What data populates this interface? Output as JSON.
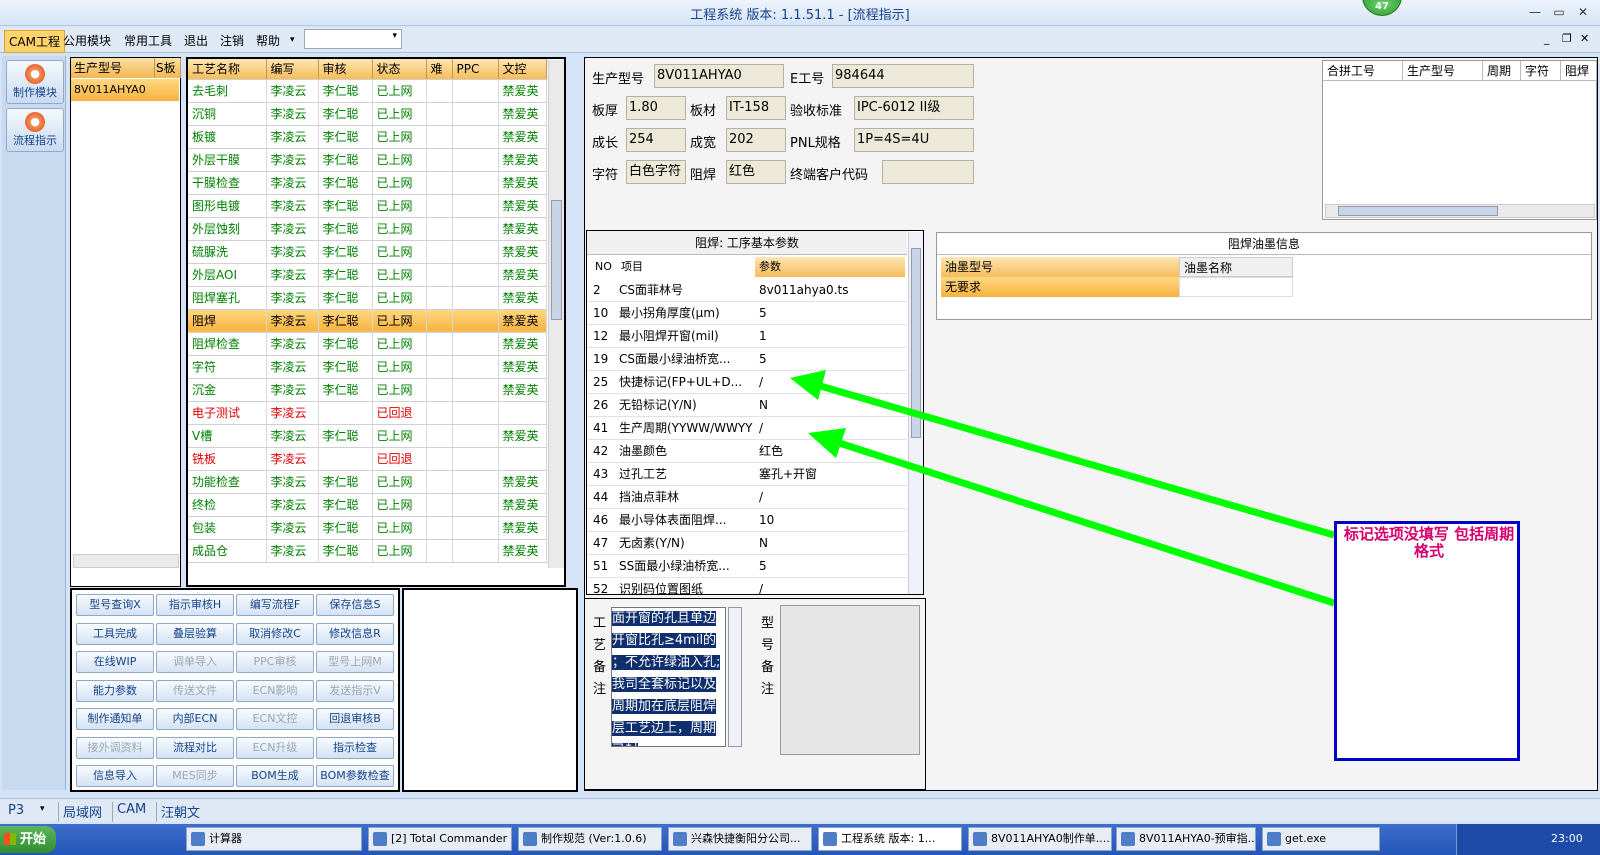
{
  "window": {
    "title": "工程系统  版本: 1.1.51.1 - [流程指示]",
    "badge_count": "47"
  },
  "menu": {
    "items": [
      "CAM工程",
      "公用模块",
      "常用工具",
      "退出",
      "注销",
      "帮助"
    ],
    "dropdown_arrow": "▾"
  },
  "rail": {
    "buttons": [
      "制作模块",
      "流程指示"
    ]
  },
  "model_list": {
    "headers": [
      "生产型号",
      "S板"
    ],
    "rows": [
      "8V011AHYA0"
    ]
  },
  "process": {
    "headers": [
      "工艺名称",
      "编写",
      "审核",
      "状态",
      "难",
      "PPC",
      "文控"
    ],
    "rows": [
      [
        "去毛刺",
        "李凌云",
        "李仁聪",
        "已上网",
        "",
        "",
        "禁爱英",
        "green"
      ],
      [
        "沉铜",
        "李凌云",
        "李仁聪",
        "已上网",
        "",
        "",
        "禁爱英",
        "green"
      ],
      [
        "板镀",
        "李凌云",
        "李仁聪",
        "已上网",
        "",
        "",
        "禁爱英",
        "green"
      ],
      [
        "外层干膜",
        "李凌云",
        "李仁聪",
        "已上网",
        "",
        "",
        "禁爱英",
        "green"
      ],
      [
        "干膜检查",
        "李凌云",
        "李仁聪",
        "已上网",
        "",
        "",
        "禁爱英",
        "green"
      ],
      [
        "图形电镀",
        "李凌云",
        "李仁聪",
        "已上网",
        "",
        "",
        "禁爱英",
        "green"
      ],
      [
        "外层蚀刻",
        "李凌云",
        "李仁聪",
        "已上网",
        "",
        "",
        "禁爱英",
        "green"
      ],
      [
        "硫脲洗",
        "李凌云",
        "李仁聪",
        "已上网",
        "",
        "",
        "禁爱英",
        "green"
      ],
      [
        "外层AOI",
        "李凌云",
        "李仁聪",
        "已上网",
        "",
        "",
        "禁爱英",
        "green"
      ],
      [
        "阻焊塞孔",
        "李凌云",
        "李仁聪",
        "已上网",
        "",
        "",
        "禁爱英",
        "green"
      ],
      [
        "阻焊",
        "李凌云",
        "李仁聪",
        "已上网",
        "",
        "",
        "禁爱英",
        "selected"
      ],
      [
        "阻焊检查",
        "李凌云",
        "李仁聪",
        "已上网",
        "",
        "",
        "禁爱英",
        "green"
      ],
      [
        "字符",
        "李凌云",
        "李仁聪",
        "已上网",
        "",
        "",
        "禁爱英",
        "green"
      ],
      [
        "沉金",
        "李凌云",
        "李仁聪",
        "已上网",
        "",
        "",
        "禁爱英",
        "green"
      ],
      [
        "电子测试",
        "李凌云",
        "",
        "已回退",
        "",
        "",
        "",
        "red"
      ],
      [
        "V槽",
        "李凌云",
        "李仁聪",
        "已上网",
        "",
        "",
        "禁爱英",
        "green"
      ],
      [
        "铣板",
        "李凌云",
        "",
        "已回退",
        "",
        "",
        "",
        "red"
      ],
      [
        "功能检查",
        "李凌云",
        "李仁聪",
        "已上网",
        "",
        "",
        "禁爱英",
        "green"
      ],
      [
        "终检",
        "李凌云",
        "李仁聪",
        "已上网",
        "",
        "",
        "禁爱英",
        "green"
      ],
      [
        "包装",
        "李凌云",
        "李仁聪",
        "已上网",
        "",
        "",
        "禁爱英",
        "green"
      ],
      [
        "成品仓",
        "李凌云",
        "李仁聪",
        "已上网",
        "",
        "",
        "禁爱英",
        "green"
      ]
    ]
  },
  "buttons": {
    "rows": [
      [
        [
          "型号查询X",
          false
        ],
        [
          "指示审核H",
          false
        ],
        [
          "编写流程F",
          false
        ],
        [
          "保存信息S",
          false
        ]
      ],
      [
        [
          "工具完成",
          false
        ],
        [
          "叠层验算",
          false
        ],
        [
          "取消修改C",
          false
        ],
        [
          "修改信息R",
          false
        ]
      ],
      [
        [
          "在线WIP",
          false
        ],
        [
          "调单导入",
          true
        ],
        [
          "PPC审核",
          true
        ],
        [
          "型号上网M",
          true
        ]
      ],
      [
        [
          "能力参数",
          false
        ],
        [
          "传送文件",
          true
        ],
        [
          "ECN影响",
          true
        ],
        [
          "发送指示V",
          true
        ]
      ],
      [
        [
          "制作通知单",
          false
        ],
        [
          "内部ECN",
          false
        ],
        [
          "ECN文控",
          true
        ],
        [
          "回退审核B",
          false
        ]
      ],
      [
        [
          "接外调资料",
          true
        ],
        [
          "流程对比",
          false
        ],
        [
          "ECN升级",
          true
        ],
        [
          "指示检查",
          false
        ]
      ],
      [
        [
          "信息导入",
          false
        ],
        [
          "MES同步",
          true
        ],
        [
          "BOM生成",
          false
        ],
        [
          "BOM参数检查",
          false
        ]
      ]
    ]
  },
  "info": {
    "fields": [
      {
        "label": "生产型号",
        "value": "8V011AHYA0"
      },
      {
        "label": "E工号",
        "value": "984644"
      },
      {
        "label": "板厚",
        "value": "1.80"
      },
      {
        "label": "板材",
        "value": "IT-158"
      },
      {
        "label": "验收标准",
        "value": "IPC-6012 II级"
      },
      {
        "label": "成长",
        "value": "254"
      },
      {
        "label": "成宽",
        "value": "202"
      },
      {
        "label": "PNL规格",
        "value": "1P=4S=4U"
      },
      {
        "label": "字符",
        "value": "白色字符"
      },
      {
        "label": "阻焊",
        "value": "红色"
      },
      {
        "label": "终端客户代码",
        "value": ""
      }
    ]
  },
  "merge_grid": {
    "headers": [
      "合拼工号",
      "生产型号",
      "周期",
      "字符",
      "阻焊"
    ]
  },
  "params": {
    "title": "阻焊: 工序基本参数",
    "headers": [
      "NO",
      "项目",
      "参数"
    ],
    "rows": [
      [
        "2",
        "CS面菲林号",
        "8v011ahya0.ts"
      ],
      [
        "10",
        "最小拐角厚度(μm)",
        "5"
      ],
      [
        "12",
        "最小阻焊开窗(mil)",
        "1"
      ],
      [
        "19",
        "CS面最小绿油桥宽...",
        "5"
      ],
      [
        "25",
        "快捷标记(FP+UL+D...",
        "/"
      ],
      [
        "26",
        "无铅标记(Y/N)",
        "N"
      ],
      [
        "41",
        "生产周期(YYWW/WWYY)",
        "/"
      ],
      [
        "42",
        "油墨颜色",
        "红色"
      ],
      [
        "43",
        "过孔工艺",
        "塞孔+开窗"
      ],
      [
        "44",
        "挡油点菲林",
        "/"
      ],
      [
        "46",
        "最小导体表面阻焊...",
        "10"
      ],
      [
        "47",
        "无卤素(Y/N)",
        "N"
      ],
      [
        "51",
        "SS面最小绿油桥宽...",
        "5"
      ],
      [
        "52",
        "识别码位置图纸",
        "/"
      ]
    ]
  },
  "ink": {
    "title": "阻焊油墨信息",
    "headers": [
      "油墨型号",
      "油墨名称"
    ],
    "rows": [
      [
        "无要求",
        ""
      ]
    ]
  },
  "notes": {
    "process_label": "工艺备注",
    "model_label": "型号备注",
    "process_text": [
      "面开窗的孔且单边",
      "开窗比孔≥4mil的",
      "；不允许绿油入孔;",
      "我司全套标记以及",
      "周期加在底层阻焊",
      "层工艺边上，周期",
      "已封"
    ]
  },
  "annotation": {
    "text": "标记选项没填写   包括周期格式",
    "color": "#00ff00"
  },
  "status": {
    "items": [
      "P3",
      "局域网",
      "CAM",
      "汪朝文"
    ]
  },
  "taskbar": {
    "start": "开始",
    "tasks": [
      "计算器",
      "[2] Total Commander ...",
      "制作规范 (Ver:1.0.6)",
      "兴森快捷衡阳分公司...",
      "工程系统  版本: 1...",
      "8V011AHYA0制作单....",
      "8V011AHYA0-预审指...",
      "get.exe"
    ],
    "clock": "23:00"
  }
}
